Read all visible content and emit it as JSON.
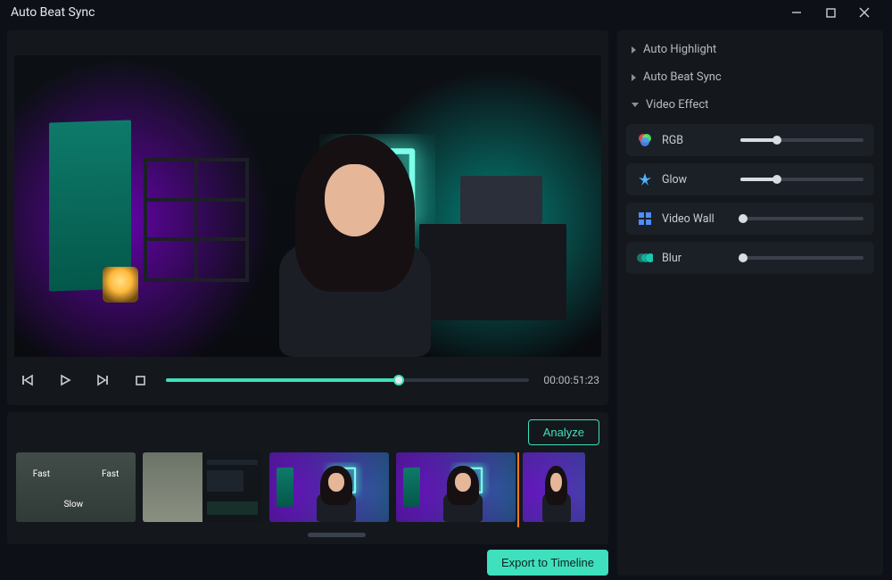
{
  "window": {
    "title": "Auto Beat Sync"
  },
  "playback": {
    "progress_pct": 64,
    "timecode": "00:00:51:23"
  },
  "analyze_label": "Analyze",
  "export_label": "Export to Timeline",
  "clips_playhead_pct": 86,
  "clips_scrollbar": {
    "left_pct": 50,
    "width_pct": 10
  },
  "clip_speed_labels": {
    "fast1": "Fast",
    "fast2": "Fast",
    "slow": "Slow"
  },
  "sidebar": {
    "items": [
      {
        "label": "Auto Highlight",
        "expanded": false
      },
      {
        "label": "Auto Beat Sync",
        "expanded": false
      },
      {
        "label": "Video Effect",
        "expanded": true
      }
    ],
    "effects": [
      {
        "name": "RGB",
        "icon": "rgb",
        "value_pct": 30
      },
      {
        "name": "Glow",
        "icon": "glow",
        "value_pct": 30
      },
      {
        "name": "Video Wall",
        "icon": "video-wall",
        "value_pct": 2
      },
      {
        "name": "Blur",
        "icon": "blur",
        "value_pct": 2
      }
    ]
  }
}
